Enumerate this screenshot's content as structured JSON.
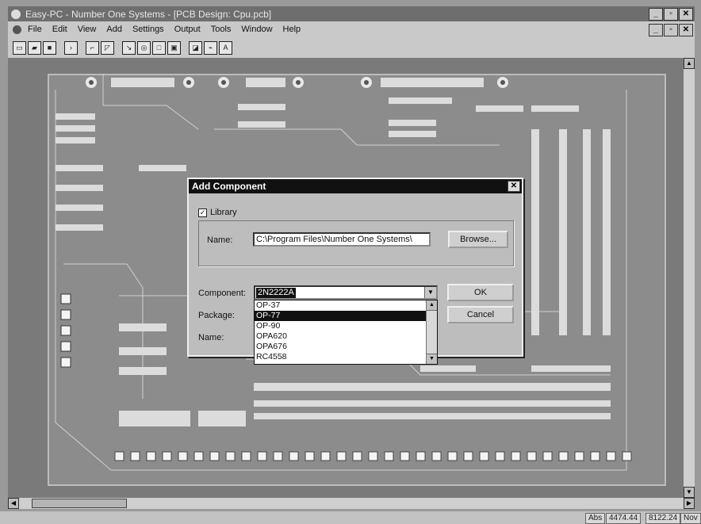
{
  "window": {
    "title": "Easy-PC - Number One Systems - [PCB Design: Cpu.pcb]",
    "controls": [
      "_",
      "▫",
      "✕"
    ]
  },
  "menu": {
    "items": [
      "File",
      "Edit",
      "View",
      "Add",
      "Settings",
      "Output",
      "Tools",
      "Window",
      "Help"
    ]
  },
  "toolbar": {
    "groups": [
      [
        "new-doc-icon",
        "open-doc-icon",
        "save-icon"
      ],
      [
        "arrow-icon"
      ],
      [
        "select-icon",
        "pointer-icon"
      ],
      [
        "track-icon",
        "via-icon",
        "pad-icon",
        "component-icon"
      ],
      [
        "copper-icon",
        "link-icon",
        "text-icon"
      ]
    ]
  },
  "dialog": {
    "title": "Add Component",
    "library_label": "Library",
    "library_checked": true,
    "name_label": "Name:",
    "name_value": "C:\\Program Files\\Number One Systems\\",
    "browse_label": "Browse...",
    "component_label": "Component:",
    "component_value": "2N2222A",
    "package_label": "Package:",
    "name2_label": "Name:",
    "ok_label": "OK",
    "cancel_label": "Cancel",
    "dropdown_items": [
      "OP-37",
      "OP-77",
      "OP-90",
      "OPA620",
      "OPA676",
      "RC4558"
    ],
    "dropdown_selected": "OP-77"
  },
  "status": {
    "mode": "Abs",
    "x": "4474.44",
    "y": "8122.24",
    "units": "Nov"
  }
}
